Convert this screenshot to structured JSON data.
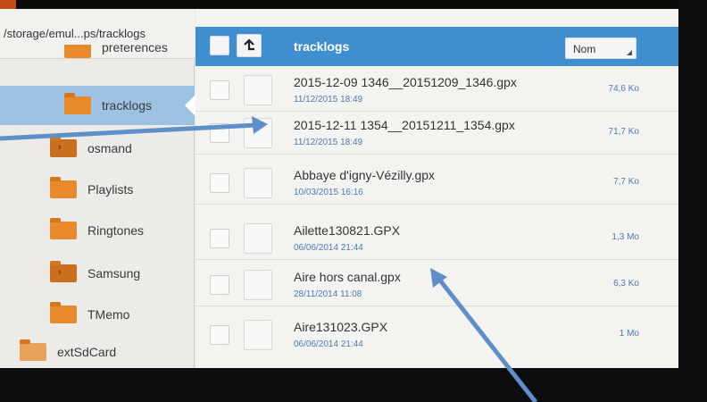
{
  "path": "/storage/emul...ps/tracklogs",
  "folders": [
    {
      "label": "preferences",
      "partial": true
    },
    {
      "label": "tracklogs",
      "selected": true
    },
    {
      "label": "osmand",
      "chevron": true
    },
    {
      "label": "Playlists"
    },
    {
      "label": "Ringtones"
    },
    {
      "label": "Samsung",
      "chevron": true
    },
    {
      "label": "TMemo"
    },
    {
      "label": "extSdCard"
    }
  ],
  "header": {
    "title": "tracklogs",
    "sort_label": "Nom",
    "up_icon": "up-arrow-icon"
  },
  "files": [
    {
      "name": "2015-12-09 1346__20151209_1346.gpx",
      "date": "11/12/2015 18:49",
      "size": "74,6 Ko"
    },
    {
      "name": "2015-12-11 1354__20151211_1354.gpx",
      "date": "11/12/2015 18:49",
      "size": "71,7 Ko"
    },
    {
      "name": "Abbaye d'igny-Vézilly.gpx",
      "date": "10/03/2015 16:16",
      "size": "7,7 Ko"
    },
    {
      "name": "Ailette130821.GPX",
      "date": "06/06/2014 21:44",
      "size": "1,3 Mo"
    },
    {
      "name": "Aire hors canal.gpx",
      "date": "28/11/2014 11:08",
      "size": "6,3 Ko"
    },
    {
      "name": "Aire131023.GPX",
      "date": "06/06/2014 21:44",
      "size": "1 Mo"
    }
  ],
  "colors": {
    "accent": "#3f8fd0",
    "selected_folder": "#9ec3e2",
    "folder": "#e88a2c",
    "annotation_arrow": "#5f8fc8"
  }
}
